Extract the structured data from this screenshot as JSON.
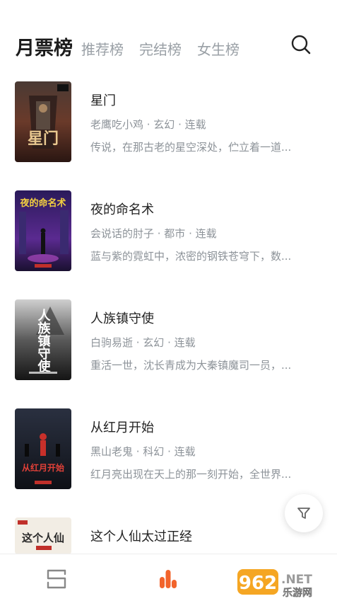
{
  "header": {
    "tabs": [
      {
        "label": "月票榜",
        "active": true
      },
      {
        "label": "推荐榜",
        "active": false
      },
      {
        "label": "完结榜",
        "active": false
      },
      {
        "label": "女生榜",
        "active": false
      }
    ],
    "search_icon": "search-icon"
  },
  "books": [
    {
      "title": "星门",
      "meta": "老鹰吃小鸡 · 玄幻 · 连载",
      "desc": "传说，在那古老的星空深处，伫立着一道...",
      "cover_title": "星门",
      "cover_colors": [
        "#3a2a24",
        "#8a4a2a",
        "#c9372c"
      ]
    },
    {
      "title": "夜的命名术",
      "meta": "会说话的肘子 · 都市 · 连载",
      "desc": "蓝与紫的霓虹中，浓密的钢铁苍穹下，数...",
      "cover_title": "夜的命名术",
      "cover_colors": [
        "#2a1a5a",
        "#7a3ab0",
        "#e0c040"
      ]
    },
    {
      "title": "人族镇守使",
      "meta": "白驹易逝 · 玄幻 · 连载",
      "desc": "重活一世，沈长青成为大秦镇魔司一员，...",
      "cover_title": "人族镇守使",
      "cover_colors": [
        "#1a1a1a",
        "#5a5a5a",
        "#d8d8d8"
      ]
    },
    {
      "title": "从红月开始",
      "meta": "黑山老鬼 · 科幻 · 连载",
      "desc": "红月亮出现在天上的那一刻开始，全世界...",
      "cover_title": "从红月开始",
      "cover_colors": [
        "#141820",
        "#3a4050",
        "#c8302a"
      ]
    },
    {
      "title": "这个人仙太过正经",
      "meta": "",
      "desc": "",
      "cover_title": "这个人仙",
      "cover_colors": [
        "#f2ede4",
        "#c8b89a",
        "#c0302a"
      ]
    }
  ],
  "filter_icon": "filter-icon",
  "bottom_nav": [
    {
      "icon": "bookshelf-icon",
      "active": false
    },
    {
      "icon": "ranking-icon",
      "active": true,
      "color": "#f2642c"
    }
  ],
  "watermark": {
    "brand": "962",
    "domain": ".NET",
    "sub": "乐游网"
  }
}
